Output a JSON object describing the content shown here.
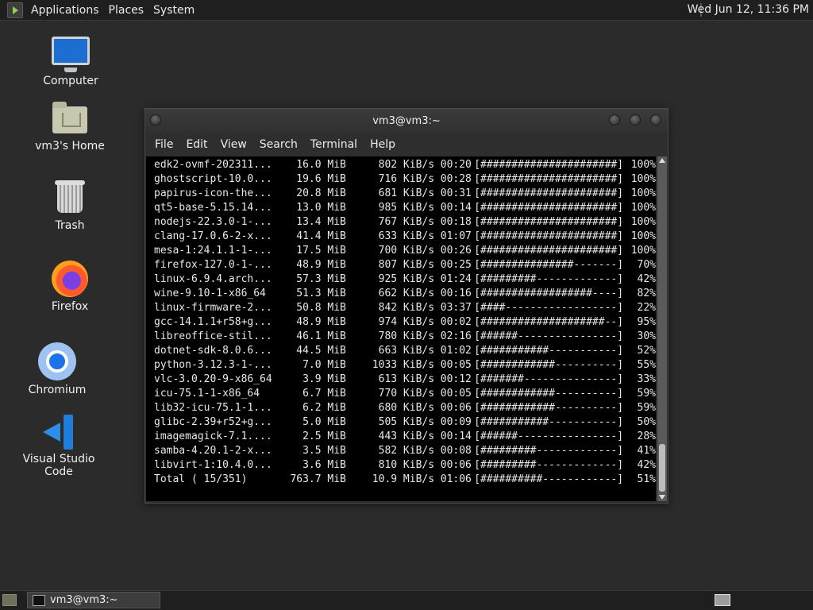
{
  "top_panel": {
    "menus": [
      "Applications",
      "Places",
      "System"
    ],
    "clock": "Wed Jun 12, 11:36 PM"
  },
  "desktop_icons": [
    {
      "label": "Computer",
      "icon": "computer-icon"
    },
    {
      "label": "vm3's Home",
      "icon": "home-folder-icon"
    },
    {
      "label": "Trash",
      "icon": "trash-icon"
    },
    {
      "label": "Firefox",
      "icon": "firefox-icon"
    },
    {
      "label": "Chromium",
      "icon": "chromium-icon"
    },
    {
      "label": "Visual Studio Code",
      "icon": "vscode-icon"
    }
  ],
  "window": {
    "title": "vm3@vm3:~",
    "menus": [
      "File",
      "Edit",
      "View",
      "Search",
      "Terminal",
      "Help"
    ]
  },
  "terminal": {
    "rows": [
      {
        "name": "edk2-ovmf-202311...",
        "size": "16.0 MiB",
        "speed": "802 KiB/s",
        "time": "00:20",
        "bar": "[######################]",
        "pct": "100%"
      },
      {
        "name": "ghostscript-10.0...",
        "size": "19.6 MiB",
        "speed": "716 KiB/s",
        "time": "00:28",
        "bar": "[######################]",
        "pct": "100%"
      },
      {
        "name": "papirus-icon-the...",
        "size": "20.8 MiB",
        "speed": "681 KiB/s",
        "time": "00:31",
        "bar": "[######################]",
        "pct": "100%"
      },
      {
        "name": "qt5-base-5.15.14...",
        "size": "13.0 MiB",
        "speed": "985 KiB/s",
        "time": "00:14",
        "bar": "[######################]",
        "pct": "100%"
      },
      {
        "name": "nodejs-22.3.0-1-...",
        "size": "13.4 MiB",
        "speed": "767 KiB/s",
        "time": "00:18",
        "bar": "[######################]",
        "pct": "100%"
      },
      {
        "name": "clang-17.0.6-2-x...",
        "size": "41.4 MiB",
        "speed": "633 KiB/s",
        "time": "01:07",
        "bar": "[######################]",
        "pct": "100%"
      },
      {
        "name": "mesa-1:24.1.1-1-...",
        "size": "17.5 MiB",
        "speed": "700 KiB/s",
        "time": "00:26",
        "bar": "[######################]",
        "pct": "100%"
      },
      {
        "name": "firefox-127.0-1-...",
        "size": "48.9 MiB",
        "speed": "807 KiB/s",
        "time": "00:25",
        "bar": "[###############-------]",
        "pct": "70%"
      },
      {
        "name": "linux-6.9.4.arch...",
        "size": "57.3 MiB",
        "speed": "925 KiB/s",
        "time": "01:24",
        "bar": "[#########-------------]",
        "pct": "42%"
      },
      {
        "name": "wine-9.10-1-x86_64",
        "size": "51.3 MiB",
        "speed": "662 KiB/s",
        "time": "00:16",
        "bar": "[##################----]",
        "pct": "82%"
      },
      {
        "name": "linux-firmware-2...",
        "size": "50.8 MiB",
        "speed": "842 KiB/s",
        "time": "03:37",
        "bar": "[####------------------]",
        "pct": "22%"
      },
      {
        "name": "gcc-14.1.1+r58+g...",
        "size": "48.9 MiB",
        "speed": "974 KiB/s",
        "time": "00:02",
        "bar": "[####################--]",
        "pct": "95%"
      },
      {
        "name": "libreoffice-stil...",
        "size": "46.1 MiB",
        "speed": "780 KiB/s",
        "time": "02:16",
        "bar": "[######----------------]",
        "pct": "30%"
      },
      {
        "name": "dotnet-sdk-8.0.6...",
        "size": "44.5 MiB",
        "speed": "663 KiB/s",
        "time": "01:02",
        "bar": "[###########-----------]",
        "pct": "52%"
      },
      {
        "name": "python-3.12.3-1-...",
        "size": "7.0 MiB",
        "speed": "1033 KiB/s",
        "time": "00:05",
        "bar": "[############----------]",
        "pct": "55%"
      },
      {
        "name": "vlc-3.0.20-9-x86_64",
        "size": "3.9 MiB",
        "speed": "613 KiB/s",
        "time": "00:12",
        "bar": "[#######---------------]",
        "pct": "33%"
      },
      {
        "name": "icu-75.1-1-x86_64",
        "size": "6.7 MiB",
        "speed": "770 KiB/s",
        "time": "00:05",
        "bar": "[############----------]",
        "pct": "59%"
      },
      {
        "name": "lib32-icu-75.1-1...",
        "size": "6.2 MiB",
        "speed": "680 KiB/s",
        "time": "00:06",
        "bar": "[############----------]",
        "pct": "59%"
      },
      {
        "name": "glibc-2.39+r52+g...",
        "size": "5.0 MiB",
        "speed": "505 KiB/s",
        "time": "00:09",
        "bar": "[###########-----------]",
        "pct": "50%"
      },
      {
        "name": "imagemagick-7.1....",
        "size": "2.5 MiB",
        "speed": "443 KiB/s",
        "time": "00:14",
        "bar": "[######----------------]",
        "pct": "28%"
      },
      {
        "name": "samba-4.20.1-2-x...",
        "size": "3.5 MiB",
        "speed": "582 KiB/s",
        "time": "00:08",
        "bar": "[#########-------------]",
        "pct": "41%"
      },
      {
        "name": "libvirt-1:10.4.0...",
        "size": "3.6 MiB",
        "speed": "810 KiB/s",
        "time": "00:06",
        "bar": "[#########-------------]",
        "pct": "42%"
      },
      {
        "name": "Total ( 15/351)",
        "size": "763.7 MiB",
        "speed": "10.9 MiB/s",
        "time": "01:06",
        "bar": "[##########------------]",
        "pct": "51%"
      }
    ]
  },
  "taskbar": {
    "task_label": "vm3@vm3:~"
  }
}
